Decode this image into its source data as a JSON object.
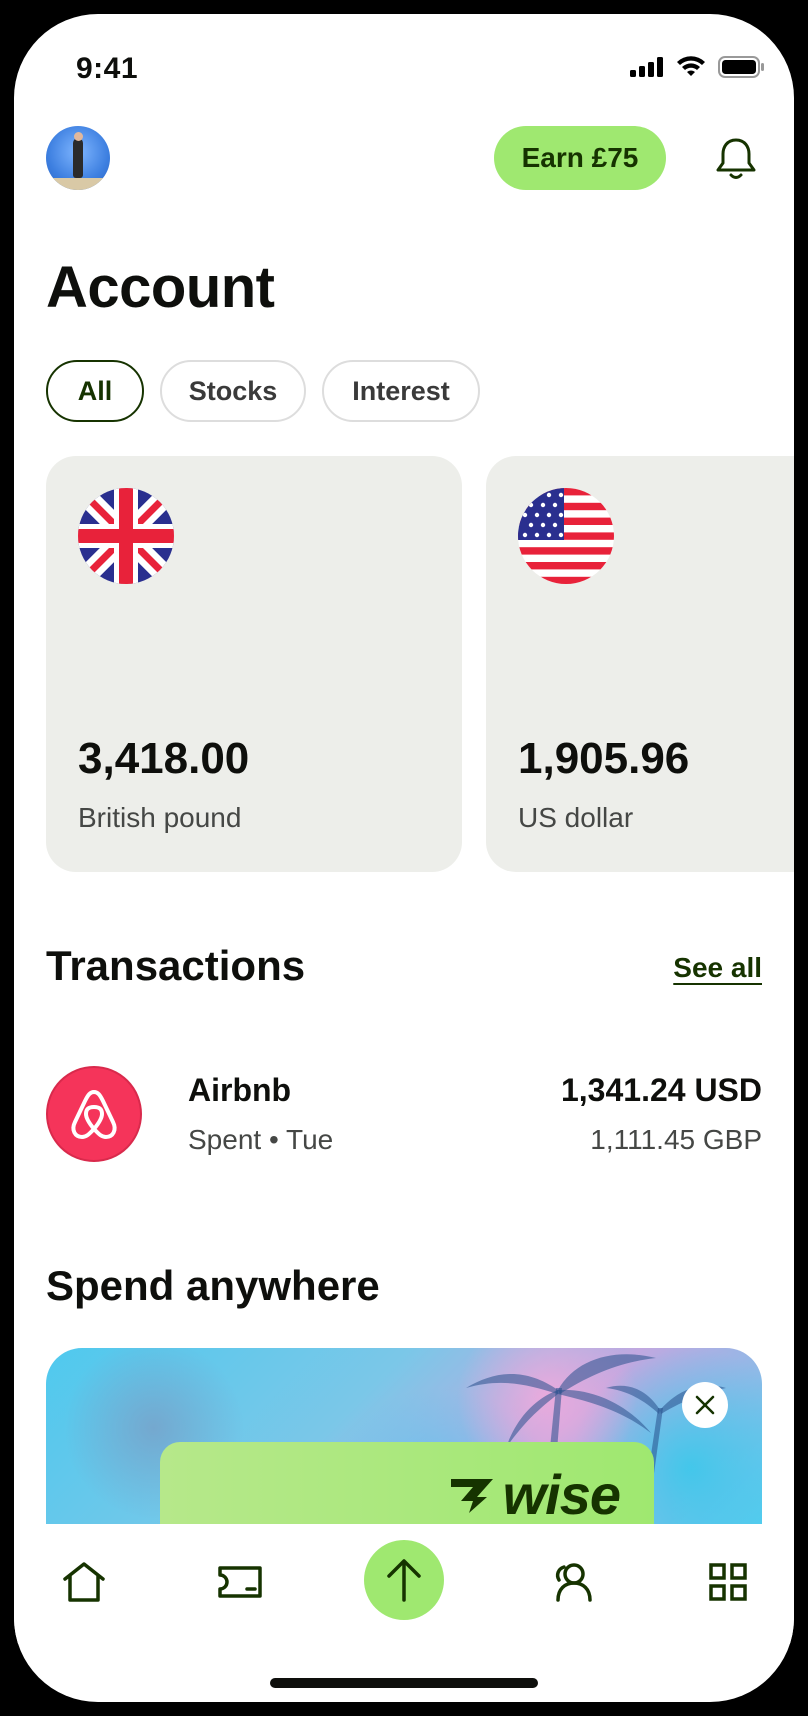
{
  "status_bar": {
    "time": "9:41"
  },
  "header": {
    "earn_label": "Earn £75"
  },
  "page_title": "Account",
  "filters": [
    {
      "label": "All",
      "active": true
    },
    {
      "label": "Stocks",
      "active": false
    },
    {
      "label": "Interest",
      "active": false
    }
  ],
  "accounts": [
    {
      "amount": "3,418.00",
      "currency": "British pound",
      "flag": "uk-flag-icon"
    },
    {
      "amount": "1,905.96",
      "currency": "US dollar",
      "flag": "us-flag-icon"
    }
  ],
  "transactions": {
    "title": "Transactions",
    "see_all": "See all",
    "items": [
      {
        "merchant": "Airbnb",
        "subtitle": "Spent • Tue",
        "amount": "1,341.24 USD",
        "converted": "1,111.45 GBP",
        "icon": "airbnb-logo-icon"
      }
    ]
  },
  "promo": {
    "title": "Spend anywhere",
    "brand": "wise"
  },
  "nav": [
    "home-icon",
    "card-icon",
    "send-icon",
    "recipients-icon",
    "apps-icon"
  ],
  "colors": {
    "accent": "#9fe870",
    "forest": "#163300",
    "card_bg": "#edeeea",
    "airbnb": "#f5345a"
  }
}
